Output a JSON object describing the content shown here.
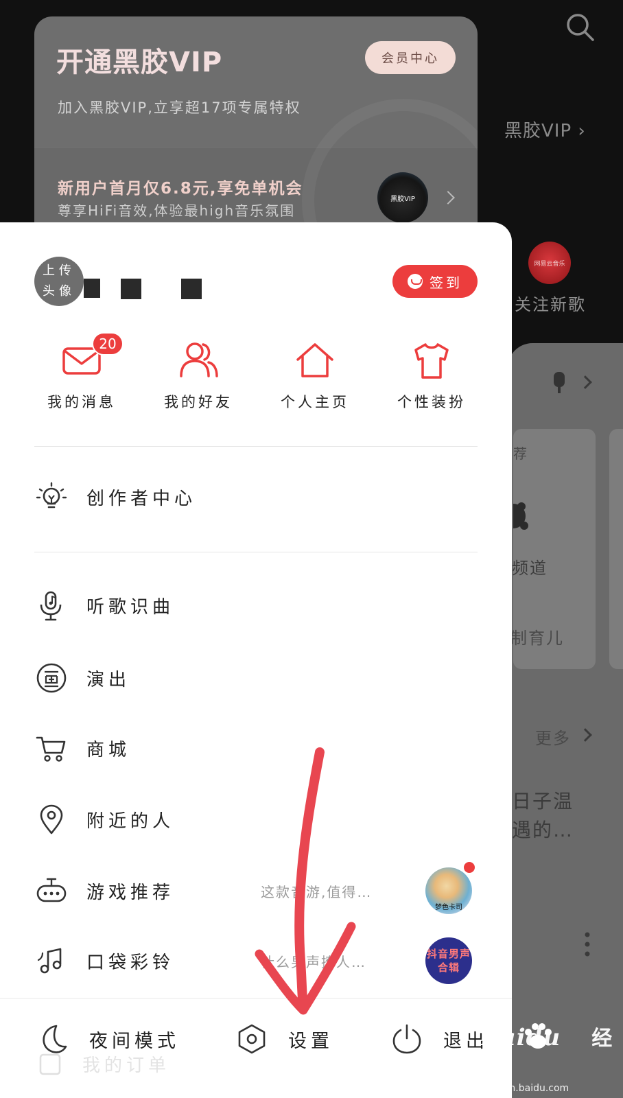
{
  "background": {
    "vip_link": "黑胶VIP",
    "follow_label": "关注新歌",
    "avatar_text": "网易云音乐",
    "card_top_label": "荐",
    "channel_label": "频道",
    "channel_sub": "制育儿",
    "more_label": "更多",
    "song_line1": "日子温",
    "song_line2": "遇的…"
  },
  "vip_card": {
    "title": "开通黑胶VIP",
    "subtitle": "加入黑胶VIP,立享超17项专属特权",
    "center_button": "会员中心",
    "promo_title": "新用户首月仅6.8元,享免单机会",
    "promo_subtitle": "尊享HiFi音效,体验最high音乐氛围",
    "promo_disc_label": "黑胶VIP"
  },
  "profile": {
    "avatar_text_line1": "上传",
    "avatar_text_line2": "头像",
    "checkin_label": "签到"
  },
  "quick_actions": [
    {
      "label": "我的消息",
      "icon": "mail-icon",
      "badge": "20"
    },
    {
      "label": "我的好友",
      "icon": "friends-icon"
    },
    {
      "label": "个人主页",
      "icon": "home-icon"
    },
    {
      "label": "个性装扮",
      "icon": "tshirt-icon"
    }
  ],
  "menu": {
    "creator_center": "创作者中心",
    "items": [
      {
        "label": "听歌识曲",
        "icon": "mic-music-icon"
      },
      {
        "label": "演出",
        "icon": "ticket-icon"
      },
      {
        "label": "商城",
        "icon": "cart-icon"
      },
      {
        "label": "附近的人",
        "icon": "location-icon"
      },
      {
        "label": "游戏推荐",
        "icon": "gamepad-icon",
        "hint": "这款音游,值得…",
        "thumb_text": "梦色卡司"
      },
      {
        "label": "口袋彩铃",
        "icon": "ringtone-icon",
        "hint": "什么男声撩人…",
        "thumb_text": "抖音男声合辑"
      }
    ]
  },
  "bottom_bar": {
    "night_mode": "夜间模式",
    "settings": "设置",
    "logout": "退出",
    "peek": "我的订单"
  },
  "watermark": {
    "brand": "Baidu",
    "brand_cn": "经验",
    "url": "jingyan.baidu.com"
  },
  "colors": {
    "accent": "#ec3d3d",
    "annotation_arrow": "#e84650"
  }
}
